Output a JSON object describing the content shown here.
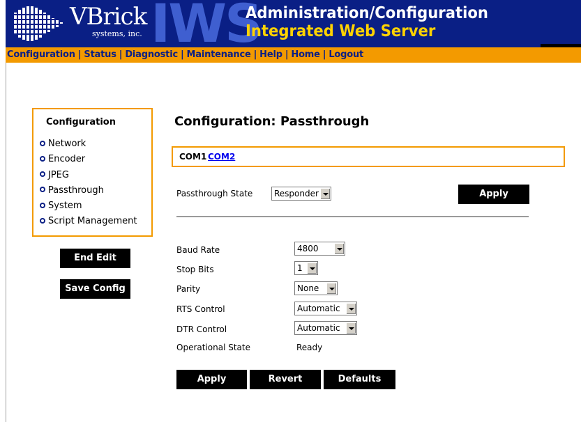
{
  "header": {
    "brand": "VBrick",
    "brand_sub": "systems, inc.",
    "product": "IWS",
    "title": "Administration/Configuration",
    "subtitle": "Integrated Web Server"
  },
  "nav": {
    "configuration": "Configuration",
    "status": "Status",
    "diagnostic": "Diagnostic",
    "maintenance": "Maintenance",
    "help": "Help",
    "home": "Home",
    "logout": "Logout",
    "separator": "|"
  },
  "sidebar": {
    "title": "Configuration",
    "items": [
      {
        "label": "Network"
      },
      {
        "label": "Encoder"
      },
      {
        "label": "JPEG"
      },
      {
        "label": "Passthrough"
      },
      {
        "label": "System"
      },
      {
        "label": "Script Management"
      }
    ],
    "end_edit": "End Edit",
    "save_config": "Save Config"
  },
  "main": {
    "title": "Configuration: Passthrough",
    "tabs": {
      "com1": "COM1",
      "com2": "COM2"
    },
    "state_label": "Passthrough State",
    "state_value": "Responder",
    "apply_top": "Apply",
    "fields": {
      "baud_rate": {
        "label": "Baud Rate",
        "value": "4800"
      },
      "stop_bits": {
        "label": "Stop Bits",
        "value": "1"
      },
      "parity": {
        "label": "Parity",
        "value": "None"
      },
      "rts": {
        "label": "RTS Control",
        "value": "Automatic"
      },
      "dtr": {
        "label": "DTR Control",
        "value": "Automatic"
      },
      "op_state": {
        "label": "Operational State",
        "value": "Ready"
      }
    },
    "buttons": {
      "apply": "Apply",
      "revert": "Revert",
      "defaults": "Defaults"
    }
  },
  "colors": {
    "header_bg": "#0a1f85",
    "nav_bg": "#f39a00",
    "accent_yellow": "#ffd200",
    "link": "#0000ee"
  }
}
